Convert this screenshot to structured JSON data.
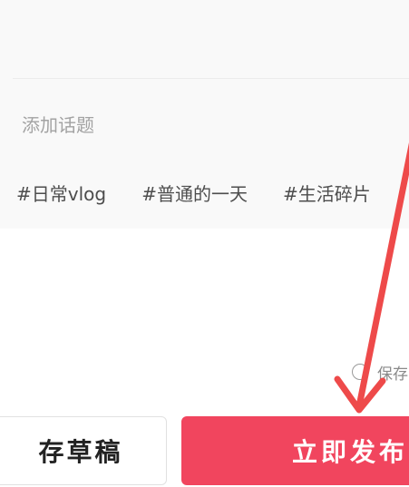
{
  "topic": {
    "placeholder": "添加话题"
  },
  "tags": [
    "#日常vlog",
    "#普通的一天",
    "#生活碎片"
  ],
  "save_option": {
    "label": "保存"
  },
  "buttons": {
    "draft": "存草稿",
    "publish": "立即发布"
  },
  "colors": {
    "accent": "#f1455e",
    "arrow": "#ee4a4a",
    "panel": "#f9f9f9"
  },
  "annotation": {
    "icon": "red-arrow-icon"
  }
}
